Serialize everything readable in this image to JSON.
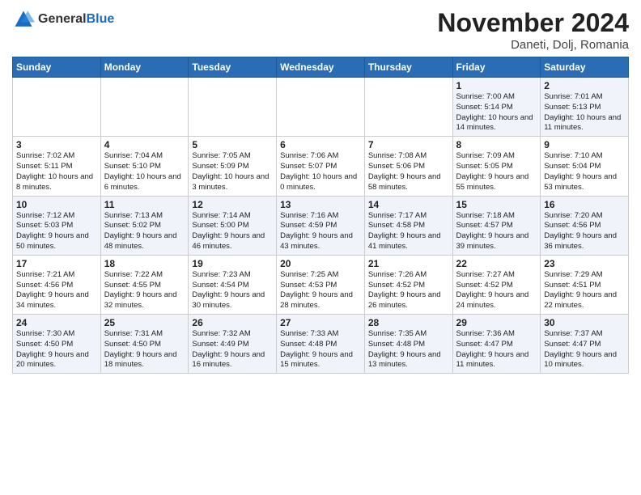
{
  "header": {
    "logo_general": "General",
    "logo_blue": "Blue",
    "month_title": "November 2024",
    "location": "Daneti, Dolj, Romania"
  },
  "weekdays": [
    "Sunday",
    "Monday",
    "Tuesday",
    "Wednesday",
    "Thursday",
    "Friday",
    "Saturday"
  ],
  "weeks": [
    [
      {
        "day": "",
        "info": ""
      },
      {
        "day": "",
        "info": ""
      },
      {
        "day": "",
        "info": ""
      },
      {
        "day": "",
        "info": ""
      },
      {
        "day": "",
        "info": ""
      },
      {
        "day": "1",
        "info": "Sunrise: 7:00 AM\nSunset: 5:14 PM\nDaylight: 10 hours and 14 minutes."
      },
      {
        "day": "2",
        "info": "Sunrise: 7:01 AM\nSunset: 5:13 PM\nDaylight: 10 hours and 11 minutes."
      }
    ],
    [
      {
        "day": "3",
        "info": "Sunrise: 7:02 AM\nSunset: 5:11 PM\nDaylight: 10 hours and 8 minutes."
      },
      {
        "day": "4",
        "info": "Sunrise: 7:04 AM\nSunset: 5:10 PM\nDaylight: 10 hours and 6 minutes."
      },
      {
        "day": "5",
        "info": "Sunrise: 7:05 AM\nSunset: 5:09 PM\nDaylight: 10 hours and 3 minutes."
      },
      {
        "day": "6",
        "info": "Sunrise: 7:06 AM\nSunset: 5:07 PM\nDaylight: 10 hours and 0 minutes."
      },
      {
        "day": "7",
        "info": "Sunrise: 7:08 AM\nSunset: 5:06 PM\nDaylight: 9 hours and 58 minutes."
      },
      {
        "day": "8",
        "info": "Sunrise: 7:09 AM\nSunset: 5:05 PM\nDaylight: 9 hours and 55 minutes."
      },
      {
        "day": "9",
        "info": "Sunrise: 7:10 AM\nSunset: 5:04 PM\nDaylight: 9 hours and 53 minutes."
      }
    ],
    [
      {
        "day": "10",
        "info": "Sunrise: 7:12 AM\nSunset: 5:03 PM\nDaylight: 9 hours and 50 minutes."
      },
      {
        "day": "11",
        "info": "Sunrise: 7:13 AM\nSunset: 5:02 PM\nDaylight: 9 hours and 48 minutes."
      },
      {
        "day": "12",
        "info": "Sunrise: 7:14 AM\nSunset: 5:00 PM\nDaylight: 9 hours and 46 minutes."
      },
      {
        "day": "13",
        "info": "Sunrise: 7:16 AM\nSunset: 4:59 PM\nDaylight: 9 hours and 43 minutes."
      },
      {
        "day": "14",
        "info": "Sunrise: 7:17 AM\nSunset: 4:58 PM\nDaylight: 9 hours and 41 minutes."
      },
      {
        "day": "15",
        "info": "Sunrise: 7:18 AM\nSunset: 4:57 PM\nDaylight: 9 hours and 39 minutes."
      },
      {
        "day": "16",
        "info": "Sunrise: 7:20 AM\nSunset: 4:56 PM\nDaylight: 9 hours and 36 minutes."
      }
    ],
    [
      {
        "day": "17",
        "info": "Sunrise: 7:21 AM\nSunset: 4:56 PM\nDaylight: 9 hours and 34 minutes."
      },
      {
        "day": "18",
        "info": "Sunrise: 7:22 AM\nSunset: 4:55 PM\nDaylight: 9 hours and 32 minutes."
      },
      {
        "day": "19",
        "info": "Sunrise: 7:23 AM\nSunset: 4:54 PM\nDaylight: 9 hours and 30 minutes."
      },
      {
        "day": "20",
        "info": "Sunrise: 7:25 AM\nSunset: 4:53 PM\nDaylight: 9 hours and 28 minutes."
      },
      {
        "day": "21",
        "info": "Sunrise: 7:26 AM\nSunset: 4:52 PM\nDaylight: 9 hours and 26 minutes."
      },
      {
        "day": "22",
        "info": "Sunrise: 7:27 AM\nSunset: 4:52 PM\nDaylight: 9 hours and 24 minutes."
      },
      {
        "day": "23",
        "info": "Sunrise: 7:29 AM\nSunset: 4:51 PM\nDaylight: 9 hours and 22 minutes."
      }
    ],
    [
      {
        "day": "24",
        "info": "Sunrise: 7:30 AM\nSunset: 4:50 PM\nDaylight: 9 hours and 20 minutes."
      },
      {
        "day": "25",
        "info": "Sunrise: 7:31 AM\nSunset: 4:50 PM\nDaylight: 9 hours and 18 minutes."
      },
      {
        "day": "26",
        "info": "Sunrise: 7:32 AM\nSunset: 4:49 PM\nDaylight: 9 hours and 16 minutes."
      },
      {
        "day": "27",
        "info": "Sunrise: 7:33 AM\nSunset: 4:48 PM\nDaylight: 9 hours and 15 minutes."
      },
      {
        "day": "28",
        "info": "Sunrise: 7:35 AM\nSunset: 4:48 PM\nDaylight: 9 hours and 13 minutes."
      },
      {
        "day": "29",
        "info": "Sunrise: 7:36 AM\nSunset: 4:47 PM\nDaylight: 9 hours and 11 minutes."
      },
      {
        "day": "30",
        "info": "Sunrise: 7:37 AM\nSunset: 4:47 PM\nDaylight: 9 hours and 10 minutes."
      }
    ]
  ]
}
